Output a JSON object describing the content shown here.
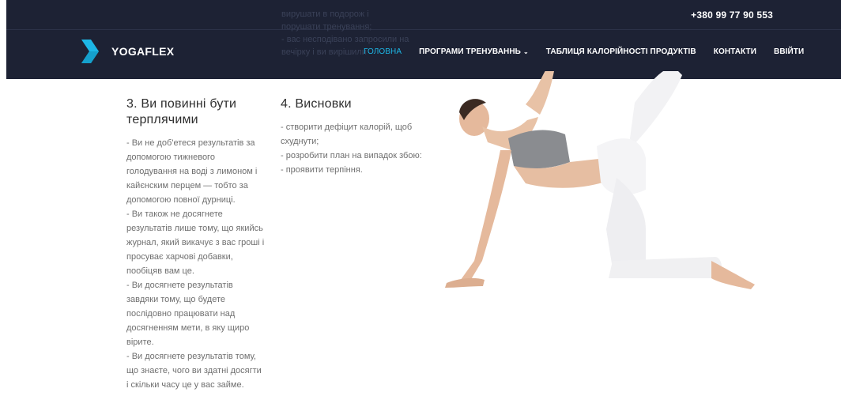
{
  "header": {
    "phone": "+380 99 77 90 553",
    "ghost_text": "вирушати в подорож і\nпорушати тренування;\n- вас несподівано запросили на\nвечірку і ви вирішили",
    "logo_text": "YOGAFLEX",
    "nav": [
      {
        "label": "ГОЛОВНА",
        "active": true
      },
      {
        "label": "ПРОГРАМИ ТРЕНУВАННЬ"
      },
      {
        "label": "ТАБЛИЦЯ КАЛОРІЙНОСТІ ПРОДУКТІВ"
      },
      {
        "label": "КОНТАКТИ"
      },
      {
        "label": "ВВІЙТИ"
      }
    ]
  },
  "sections": [
    {
      "title": "3. Ви повинні бути терплячими",
      "body": "- Ви не доб'етеся результатів за допомогою тижневого голодування на воді з лимоном і кайєнским перцем — тобто за допомогою повної дурниці.\n- Ви також не досягнете результатів лише тому, що якийсь журнал, який викачує з вас гроші і просуває харчові добавки, пообіцяв вам це.\n- Ви досягнете результатів завдяки тому, що будете послідовно працювати над досягненням мети, в яку щиро вірите.\n- Ви досягнете результатів тому, що знаєте, чого ви здатні досягти і скільки часу це у вас займе."
    },
    {
      "title": "4. Висновки",
      "body": "- створити дефіцит калорій, щоб схуднути;\n- розробити план на випадок збою:\n- проявити терпіння."
    }
  ],
  "colors": {
    "header_bg": "#1d2234",
    "accent": "#1db7e6",
    "heading": "#2e2e2e",
    "body_text": "#6f6f6f"
  },
  "icons": {
    "logo": "yogaflex-logo-icon",
    "dropdown": "chevron-down-icon"
  }
}
